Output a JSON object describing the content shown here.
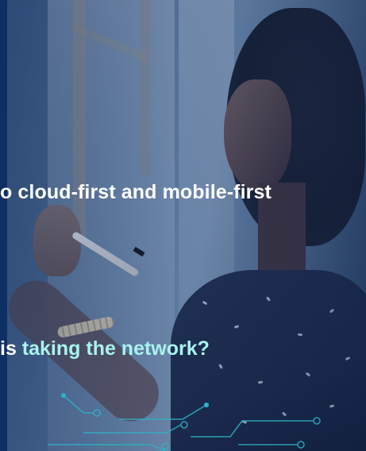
{
  "slide": {
    "headline_text": "o cloud-first and mobile-first",
    "question_plain": "is ",
    "question_accent": "taking the network?"
  },
  "colors": {
    "left_bar": "#0d2f63",
    "headline": "#ffffff",
    "accent_text": "#a8f3ee",
    "circuit_lines": "#2fb3c8"
  }
}
